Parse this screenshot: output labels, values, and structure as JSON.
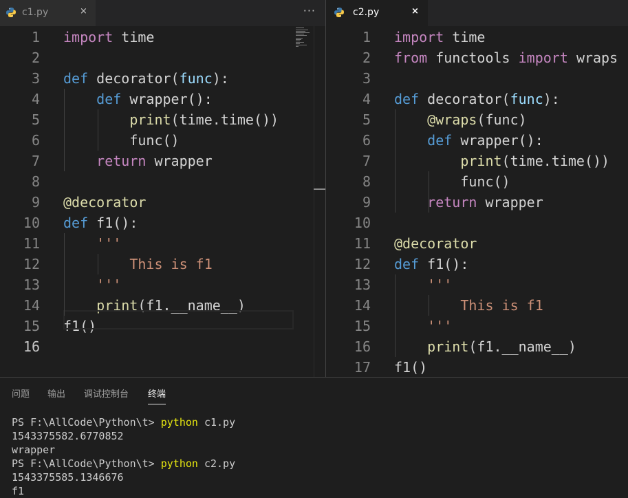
{
  "editor_left": {
    "tab": {
      "label": "c1.py",
      "close": "×"
    },
    "more_actions": "···",
    "lines": [
      {
        "n": "1",
        "tokens": [
          [
            "kw",
            "import"
          ],
          [
            "",
            "time"
          ]
        ]
      },
      {
        "n": "2",
        "tokens": []
      },
      {
        "n": "3",
        "tokens": [
          [
            "def",
            "def"
          ],
          [
            "",
            "decorator("
          ],
          [
            "prm",
            "func"
          ],
          [
            "",
            "):"
          ]
        ]
      },
      {
        "n": "4",
        "tokens": [
          [
            "",
            "    "
          ],
          [
            "def",
            "def"
          ],
          [
            "",
            "wrapper():"
          ]
        ]
      },
      {
        "n": "5",
        "tokens": [
          [
            "",
            "        "
          ],
          [
            "fn",
            "print"
          ],
          [
            "",
            "(time.time())"
          ]
        ]
      },
      {
        "n": "6",
        "tokens": [
          [
            "",
            "        func()"
          ]
        ]
      },
      {
        "n": "7",
        "tokens": [
          [
            "",
            "    "
          ],
          [
            "kw",
            "return"
          ],
          [
            "",
            "wrapper"
          ]
        ]
      },
      {
        "n": "8",
        "tokens": []
      },
      {
        "n": "9",
        "tokens": [
          [
            "fn",
            "@decorator"
          ]
        ]
      },
      {
        "n": "10",
        "tokens": [
          [
            "def",
            "def"
          ],
          [
            "",
            "f1():"
          ]
        ]
      },
      {
        "n": "11",
        "tokens": [
          [
            "",
            "    "
          ],
          [
            "str",
            "'''"
          ]
        ]
      },
      {
        "n": "12",
        "tokens": [
          [
            "",
            "        "
          ],
          [
            "str",
            "This is f1"
          ]
        ]
      },
      {
        "n": "13",
        "tokens": [
          [
            "",
            "    "
          ],
          [
            "str",
            "'''"
          ]
        ]
      },
      {
        "n": "14",
        "tokens": [
          [
            "",
            "    "
          ],
          [
            "fn",
            "print"
          ],
          [
            "",
            "(f1.__name__)"
          ]
        ]
      },
      {
        "n": "15",
        "tokens": [
          [
            "",
            "f1()"
          ]
        ]
      },
      {
        "n": "16",
        "tokens": []
      }
    ]
  },
  "editor_right": {
    "tab": {
      "label": "c2.py",
      "close": "×"
    },
    "lines": [
      {
        "n": "1",
        "tokens": [
          [
            "kw",
            "import"
          ],
          [
            "",
            "time"
          ]
        ]
      },
      {
        "n": "2",
        "tokens": [
          [
            "kw",
            "from"
          ],
          [
            "",
            "functools"
          ],
          [
            "kw",
            "import"
          ],
          [
            "",
            "wraps"
          ]
        ]
      },
      {
        "n": "3",
        "tokens": []
      },
      {
        "n": "4",
        "tokens": [
          [
            "def",
            "def"
          ],
          [
            "",
            "decorator("
          ],
          [
            "prm",
            "func"
          ],
          [
            "",
            "):"
          ]
        ]
      },
      {
        "n": "5",
        "tokens": [
          [
            "",
            "    "
          ],
          [
            "fn",
            "@wraps"
          ],
          [
            "",
            "(func)"
          ]
        ]
      },
      {
        "n": "6",
        "tokens": [
          [
            "",
            "    "
          ],
          [
            "def",
            "def"
          ],
          [
            "",
            "wrapper():"
          ]
        ]
      },
      {
        "n": "7",
        "tokens": [
          [
            "",
            "        "
          ],
          [
            "fn",
            "print"
          ],
          [
            "",
            "(time.time())"
          ]
        ]
      },
      {
        "n": "8",
        "tokens": [
          [
            "",
            "        func()"
          ]
        ]
      },
      {
        "n": "9",
        "tokens": [
          [
            "",
            "    "
          ],
          [
            "kw",
            "return"
          ],
          [
            "",
            "wrapper"
          ]
        ]
      },
      {
        "n": "10",
        "tokens": []
      },
      {
        "n": "11",
        "tokens": [
          [
            "fn",
            "@decorator"
          ]
        ]
      },
      {
        "n": "12",
        "tokens": [
          [
            "def",
            "def"
          ],
          [
            "",
            "f1():"
          ]
        ]
      },
      {
        "n": "13",
        "tokens": [
          [
            "",
            "    "
          ],
          [
            "str",
            "'''"
          ]
        ]
      },
      {
        "n": "14",
        "tokens": [
          [
            "",
            "        "
          ],
          [
            "str",
            "This is f1"
          ]
        ]
      },
      {
        "n": "15",
        "tokens": [
          [
            "",
            "    "
          ],
          [
            "str",
            "'''"
          ]
        ]
      },
      {
        "n": "16",
        "tokens": [
          [
            "",
            "    "
          ],
          [
            "fn",
            "print"
          ],
          [
            "",
            "(f1.__name__)"
          ]
        ]
      },
      {
        "n": "17",
        "tokens": [
          [
            "",
            "f1()"
          ]
        ]
      }
    ]
  },
  "panel": {
    "tabs": [
      "问题",
      "输出",
      "调试控制台",
      "终端"
    ],
    "active_tab": "终端",
    "terminal": [
      {
        "prompt": "PS F:\\AllCode\\Python\\t> ",
        "cmd": "python",
        "args": " c1.py"
      },
      {
        "text": "1543375582.6770852"
      },
      {
        "text": "wrapper"
      },
      {
        "prompt": "PS F:\\AllCode\\Python\\t> ",
        "cmd": "python",
        "args": " c2.py"
      },
      {
        "text": "1543375585.1346676"
      },
      {
        "text": "f1"
      }
    ]
  },
  "colors": {
    "keyword": "#c586c0",
    "def": "#569cd6",
    "function": "#dcdcaa",
    "param": "#9cdcfe",
    "string": "#ce9178",
    "command": "#e5e510"
  },
  "icons": {
    "file_icon": "python-icon"
  }
}
